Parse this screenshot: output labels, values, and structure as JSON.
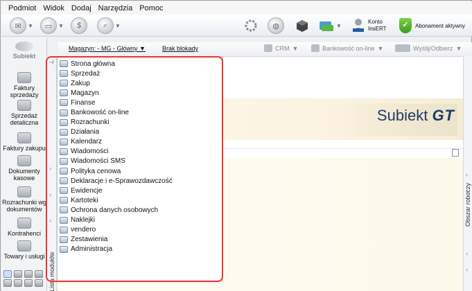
{
  "menu": [
    "Podmiot",
    "Widok",
    "Dodaj",
    "Narzędzia",
    "Pomoc"
  ],
  "toolbar": {
    "konto_line1": "Konto",
    "konto_line2": "InsERT",
    "abonament": "Abonament aktywny"
  },
  "logo": "Subiekt",
  "leftnav": [
    "Faktury sprzedaży",
    "Sprzedaż detaliczna",
    "Faktury zakupu",
    "Dokumenty kasowe",
    "Rozrachunki wg dokumentów",
    "Kontrahenci",
    "Towary i usługi"
  ],
  "infobar": {
    "magazyn": "Magazyn: - MG - Główny",
    "brak_blokady": "Brak blokady",
    "crm": "CRM",
    "bankowosc": "Bankowość on-line",
    "wyslij": "Wyślij/Odbierz"
  },
  "brand": {
    "name": "Subiekt",
    "suffix": "GT"
  },
  "modules_strip_label": "Lista modułów",
  "right_strip_label": "Obszar roboczy",
  "modules": [
    "Strona główna",
    "Sprzedaż",
    "Zakup",
    "Magazyn",
    "Finanse",
    "Bankowość on-line",
    "Rozrachunki",
    "Działania",
    "Kalendarz",
    "Wiadomości",
    "Wiadomości SMS",
    "Polityka cenowa",
    "Deklaracje i e-Sprawozdawczość",
    "Ewidencje",
    "Kartoteki",
    "Ochrona danych osobowych",
    "Naklejki",
    "vendero",
    "Zestawienia",
    "Administracja"
  ],
  "colors": {
    "highlight_box": "#e33",
    "brand": "#1d3a66",
    "abonament_ok": "#3c9a1e"
  }
}
